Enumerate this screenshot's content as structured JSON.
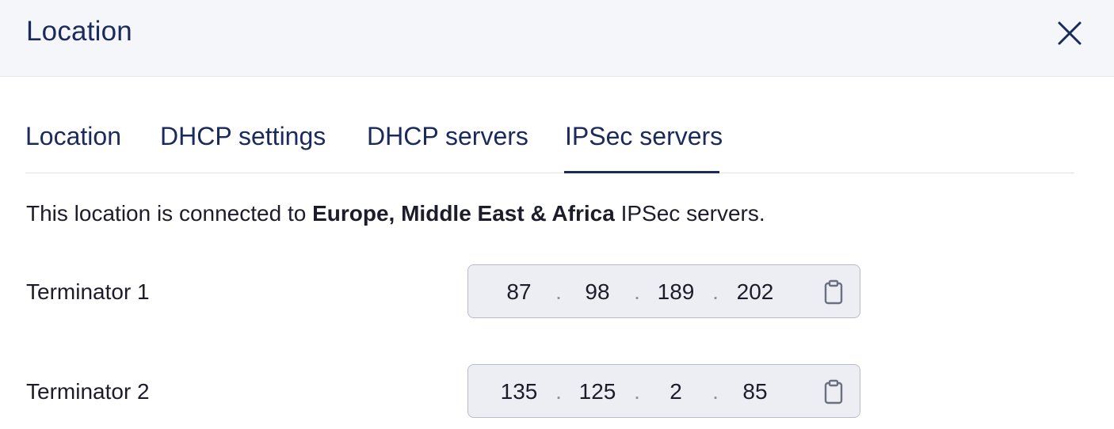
{
  "modal": {
    "title": "Location",
    "close_icon": "close-icon"
  },
  "tabs": [
    {
      "label": "Location",
      "active": false
    },
    {
      "label": "DHCP settings",
      "active": false
    },
    {
      "label": "DHCP servers",
      "active": false
    },
    {
      "label": "IPSec servers",
      "active": true
    }
  ],
  "description": {
    "prefix": "This location is connected to ",
    "region": "Europe, Middle East & Africa",
    "suffix": " IPSec servers."
  },
  "terminators": [
    {
      "label": "Terminator 1",
      "octets": [
        "87",
        "98",
        "189",
        "202"
      ],
      "separator": ".",
      "copy_icon": "clipboard-icon"
    },
    {
      "label": "Terminator 2",
      "octets": [
        "135",
        "125",
        "2",
        "85"
      ],
      "separator": ".",
      "copy_icon": "clipboard-icon"
    }
  ],
  "colors": {
    "header_bg": "#f5f6fa",
    "primary_text": "#1b2a5c",
    "body_text": "#1c1c2b",
    "field_bg": "#eceef3",
    "field_border": "#b8bcc8"
  }
}
